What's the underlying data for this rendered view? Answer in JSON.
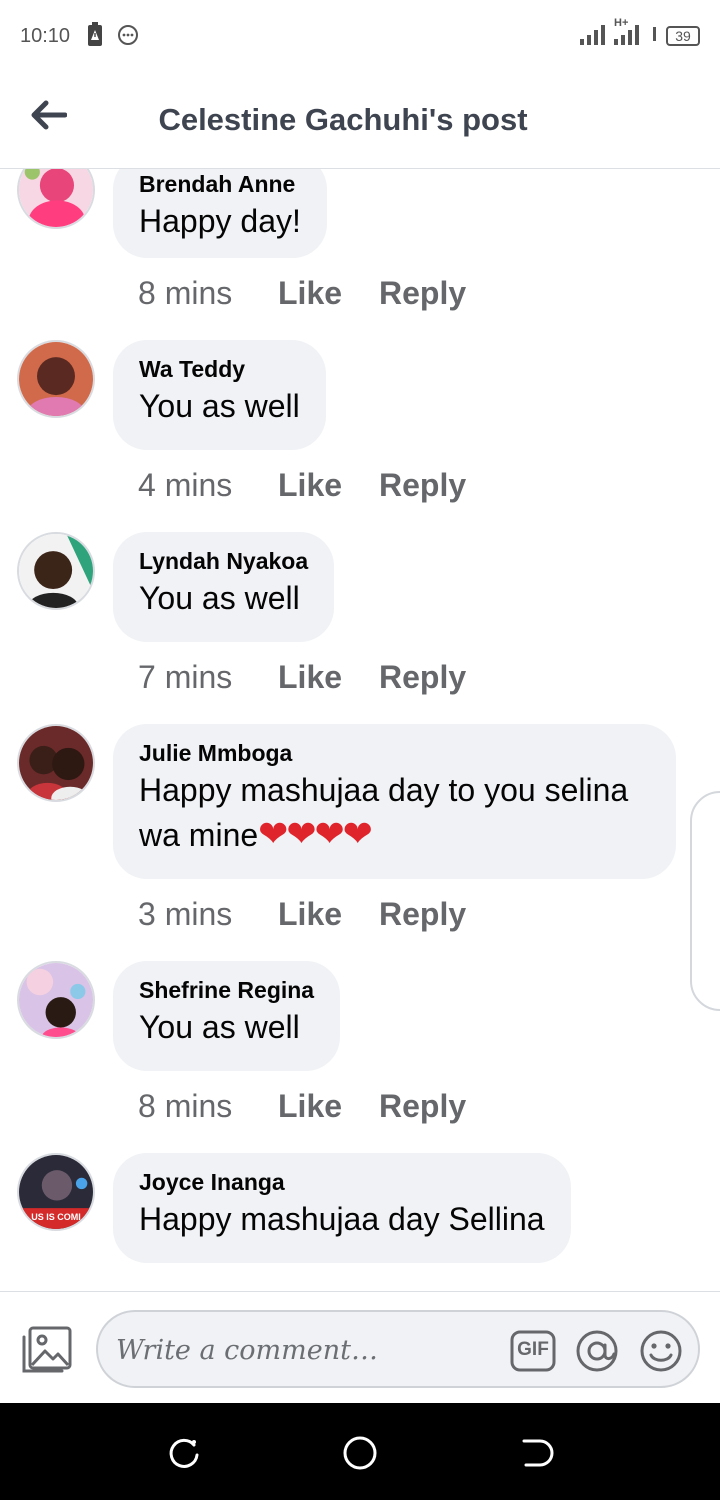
{
  "status_bar": {
    "time": "10:10",
    "network": "H+",
    "battery": "39"
  },
  "header": {
    "title": "Celestine Gachuhi's post"
  },
  "comments": [
    {
      "author": "Brendah Anne",
      "text": "Happy day!",
      "time": "8 mins",
      "like": "Like",
      "reply": "Reply",
      "avatar_color": "#e8457a"
    },
    {
      "author": "Wa Teddy",
      "text": "You as well",
      "time": "4 mins",
      "like": "Like",
      "reply": "Reply",
      "avatar_color": "#8a3a2e"
    },
    {
      "author": "Lyndah Nyakoa",
      "text": "You as well",
      "time": "7 mins",
      "like": "Like",
      "reply": "Reply",
      "avatar_color": "#2fa37c"
    },
    {
      "author": "Julie Mmboga",
      "text": "Happy mashujaa day to you selina wa mine",
      "emoji": "❤❤❤❤",
      "time": "3 mins",
      "like": "Like",
      "reply": "Reply",
      "avatar_color": "#b23a3a"
    },
    {
      "author": "Shefrine Regina",
      "text": "You as well",
      "time": "8 mins",
      "like": "Like",
      "reply": "Reply",
      "avatar_color": "#c9a8d8"
    },
    {
      "author": "Joyce Inanga",
      "text": "Happy mashujaa day Sellina",
      "avatar_text": "US IS COMI",
      "avatar_color": "#3a3a4a"
    }
  ],
  "composer": {
    "placeholder": "Write a comment…",
    "gif_label": "GIF"
  },
  "colors": {
    "bubble": "#f0f2f5",
    "meta_text": "#65676b",
    "title_text": "#3f4550",
    "heart": "#e0242c"
  }
}
